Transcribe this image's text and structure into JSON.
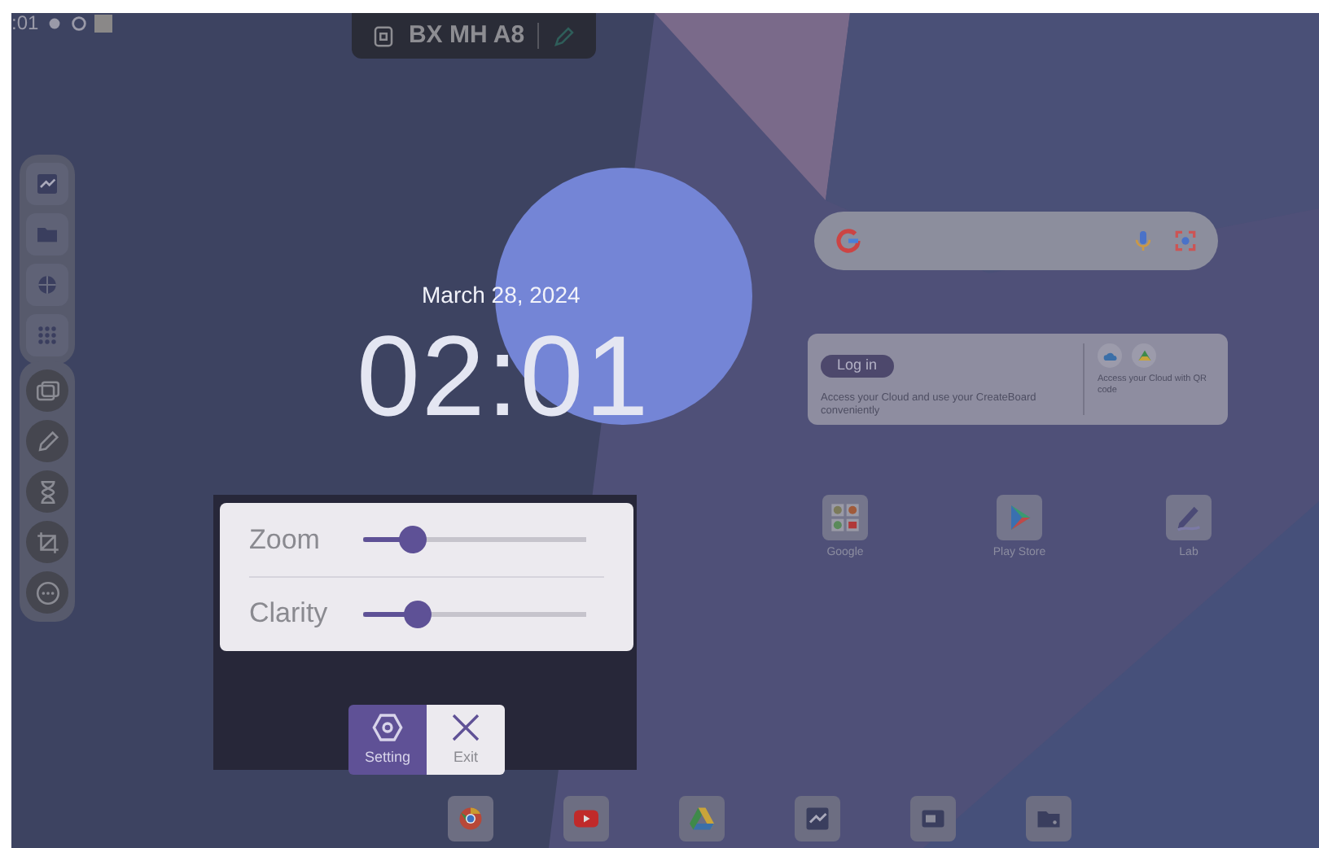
{
  "status_bar": {
    "time": ":01"
  },
  "top_pill": {
    "title": "BX MH A8"
  },
  "clock": {
    "date": "March 28, 2024",
    "time": "02:01"
  },
  "cloud_widget": {
    "login_button": "Log in",
    "message": "Access your Cloud and use your CreateBoard conveniently",
    "qr_message": "Access your Cloud with QR code"
  },
  "apps": [
    {
      "label": "Google",
      "kind": "folder"
    },
    {
      "label": "Play Store",
      "kind": "play"
    },
    {
      "label": "Lab",
      "kind": "pen"
    }
  ],
  "magnifier_panel": {
    "sliders": [
      {
        "label": "Zoom",
        "level": 0.22
      },
      {
        "label": "Clarity",
        "level": 0.24
      }
    ],
    "buttons": [
      {
        "label": "Setting",
        "kind": "setting",
        "selected": true
      },
      {
        "label": "Exit",
        "kind": "exit",
        "selected": false
      }
    ]
  }
}
